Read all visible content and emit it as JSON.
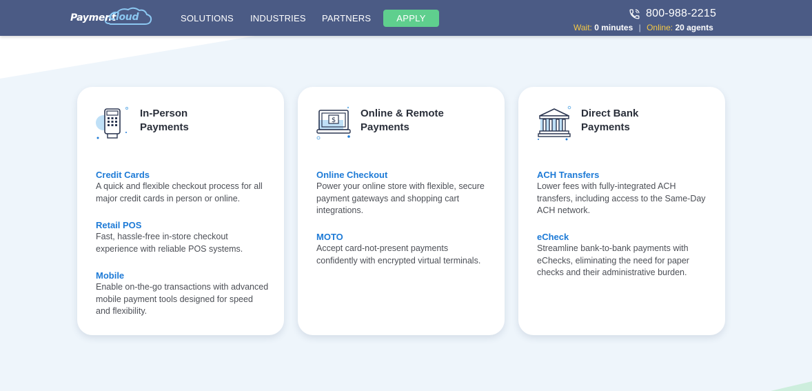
{
  "header": {
    "logo": {
      "word1": "Payment",
      "word2": "Cloud"
    },
    "nav": [
      {
        "label": "SOLUTIONS"
      },
      {
        "label": "INDUSTRIES"
      },
      {
        "label": "PARTNERS"
      }
    ],
    "apply_label": "APPLY",
    "phone": "800-988-2215",
    "status": {
      "wait_label": "Wait:",
      "wait_value": "0 minutes",
      "online_label": "Online:",
      "online_value": "20 agents"
    }
  },
  "colors": {
    "header_bg": "#4b5b85",
    "apply_bg": "#5fcf8e",
    "link_blue": "#1d7ad6",
    "status_yellow": "#f5c945"
  },
  "cards": [
    {
      "title_line1": "In-Person",
      "title_line2": "Payments",
      "icon": "pos-terminal-icon",
      "sections": [
        {
          "title": "Credit Cards",
          "desc": "A quick and flexible checkout process for all major credit cards in person or online."
        },
        {
          "title": "Retail POS",
          "desc": "Fast, hassle-free in-store checkout experience with reliable POS systems."
        },
        {
          "title": "Mobile",
          "desc": "Enable on-the-go transactions with advanced mobile payment tools designed for speed and flexibility."
        }
      ]
    },
    {
      "title_line1": "Online & Remote",
      "title_line2": "Payments",
      "icon": "laptop-dollar-icon",
      "sections": [
        {
          "title": "Online Checkout",
          "desc": "Power your online store with flexible, secure payment gateways and shopping cart integrations."
        },
        {
          "title": "MOTO",
          "desc": "Accept card-not-present payments confidently with encrypted virtual terminals."
        }
      ]
    },
    {
      "title_line1": "Direct Bank",
      "title_line2": "Payments",
      "icon": "bank-icon",
      "sections": [
        {
          "title": "ACH Transfers",
          "desc": "Lower fees with fully-integrated ACH transfers, including access to the Same-Day ACH network."
        },
        {
          "title": "eCheck",
          "desc": "Streamline bank-to-bank payments with eChecks, eliminating the need for paper checks and their administrative burden."
        }
      ]
    }
  ]
}
